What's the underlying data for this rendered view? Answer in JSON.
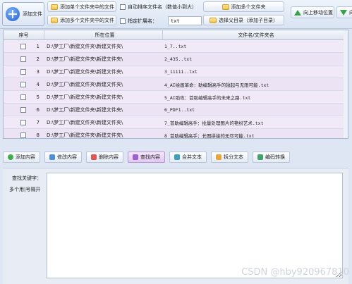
{
  "toolbar": {
    "add_file": "添加文件",
    "add_single_folder": "添加单个文件夹中的文件",
    "add_multi_folder": "添加多个文件夹中的文件",
    "auto_sort": "自动排序文件名（数值小到大）",
    "specify_ext": "指定扩展名：",
    "ext_value": "txt",
    "add_multi_folders": "添加多个文件夹",
    "select_parent": "选择父目录（添加子目录）",
    "move_up": "向上移动位置",
    "move_up_partial": "向"
  },
  "table": {
    "headers": [
      "序号",
      "所在位置",
      "文件名/文件夹名"
    ],
    "rows": [
      {
        "no": "1",
        "path": "D:\\梦工厂\\新建文件夹\\新建文件夹\\",
        "name": "1_7..txt"
      },
      {
        "no": "2",
        "path": "D:\\梦工厂\\新建文件夹\\新建文件夹\\",
        "name": "2_435..txt"
      },
      {
        "no": "3",
        "path": "D:\\梦工厂\\新建文件夹\\新建文件夹\\",
        "name": "3_11111..txt"
      },
      {
        "no": "4",
        "path": "D:\\梦工厂\\新建文件夹\\新建文件夹\\",
        "name": "4_AI绘画革命：助编辑高手的翅起与无限可能.txt"
      },
      {
        "no": "5",
        "path": "D:\\梦工厂\\新建文件夹\\新建文件夹\\",
        "name": "5_AI助攻：首助编辑高手的未来之路.txt"
      },
      {
        "no": "6",
        "path": "D:\\梦工厂\\新建文件夹\\新建文件夹\\",
        "name": "6_PDF1..txt"
      },
      {
        "no": "7",
        "path": "D:\\梦工厂\\新建文件夹\\新建文件夹\\",
        "name": "7_首助编辑高手：批量处理图片的艳纷艺术.txt"
      },
      {
        "no": "8",
        "path": "D:\\梦工厂\\新建文件夹\\新建文件夹\\",
        "name": "8_首助编辑高手：长图拼接的无尽可能.txt"
      }
    ]
  },
  "actions": {
    "add_content": "添加内容",
    "modify_content": "修改内容",
    "delete_content": "删除内容",
    "find_content": "查找内容",
    "merge_text": "合并文本",
    "split_text": "拆分文本",
    "encoding_convert": "编码转换"
  },
  "panel": {
    "keyword_label": "查找关键字：",
    "hint_label": "多个用|号隔开",
    "keyword_value": ""
  },
  "watermark": "CSDN @hby920967810"
}
